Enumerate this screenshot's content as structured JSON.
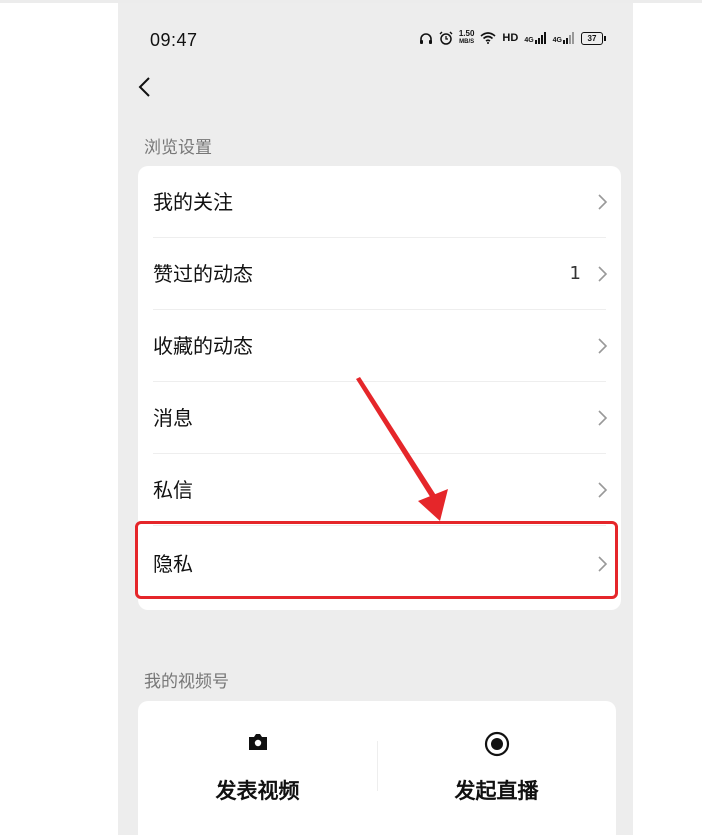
{
  "status_bar": {
    "time": "09:47",
    "net_speed_value": "1.50",
    "net_speed_unit": "MB/S",
    "hd_label": "HD",
    "signal1_label": "4G",
    "signal2_label": "4G",
    "battery": "37"
  },
  "browse_settings": {
    "section_title": "浏览设置",
    "items": [
      {
        "label": "我的关注",
        "count": ""
      },
      {
        "label": "赞过的动态",
        "count": "1"
      },
      {
        "label": "收藏的动态",
        "count": ""
      },
      {
        "label": "消息",
        "count": ""
      },
      {
        "label": "私信",
        "count": ""
      },
      {
        "label": "隐私",
        "count": ""
      }
    ]
  },
  "channels": {
    "section_title": "我的视频号",
    "actions": [
      {
        "label": "发表视频",
        "icon": "camera-icon"
      },
      {
        "label": "发起直播",
        "icon": "live-record-icon"
      }
    ]
  },
  "colors": {
    "highlight": "#e5262a",
    "page_bg": "#ededed"
  }
}
